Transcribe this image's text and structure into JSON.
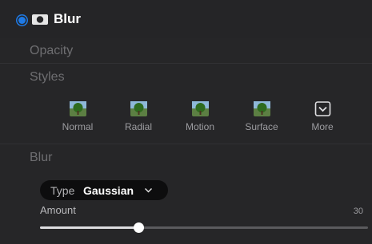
{
  "header": {
    "title": "Blur"
  },
  "sections": {
    "opacity_label": "Opacity",
    "styles_label": "Styles",
    "blur_label": "Blur"
  },
  "styles": [
    {
      "label": "Normal",
      "icon": "tree-thumbnail-icon"
    },
    {
      "label": "Radial",
      "icon": "tree-thumbnail-icon"
    },
    {
      "label": "Motion",
      "icon": "tree-thumbnail-icon"
    },
    {
      "label": "Surface",
      "icon": "tree-thumbnail-icon"
    },
    {
      "label": "More",
      "icon": "chevron-box-icon"
    }
  ],
  "blur": {
    "type_label": "Type",
    "type_value": "Gaussian",
    "amount_label": "Amount",
    "amount_value": "30",
    "amount_fraction": 0.3
  },
  "colors": {
    "accent": "#1e7ae6",
    "background": "#262628"
  }
}
